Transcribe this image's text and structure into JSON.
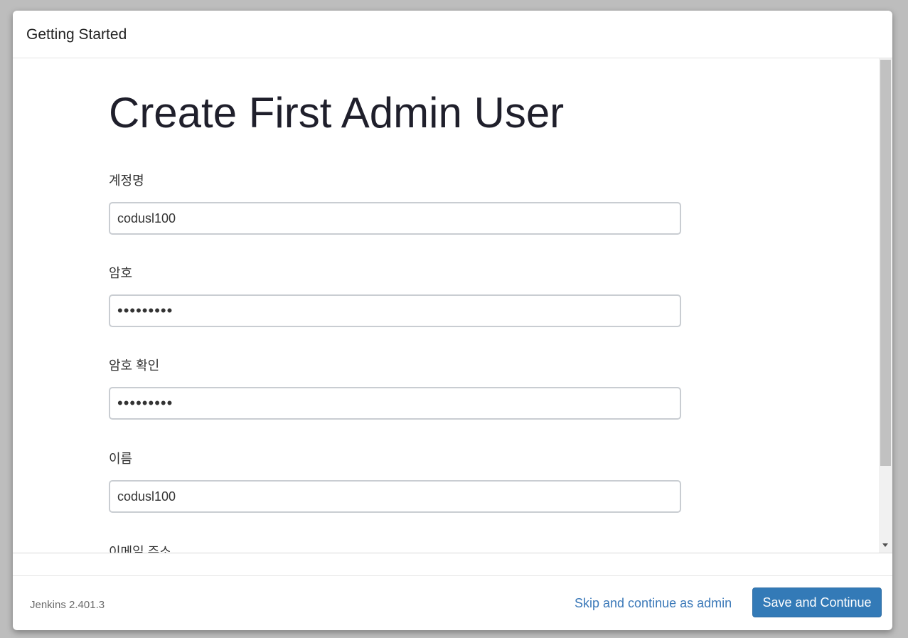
{
  "header": {
    "title": "Getting Started"
  },
  "form": {
    "title": "Create First Admin User",
    "fields": [
      {
        "label": "계정명",
        "value": "codusl100",
        "type": "text"
      },
      {
        "label": "암호",
        "value": "•••••••••",
        "type": "password"
      },
      {
        "label": "암호 확인",
        "value": "•••••••••",
        "type": "password"
      },
      {
        "label": "이름",
        "value": "codusl100",
        "type": "text"
      },
      {
        "label": "이메일 주소"
      }
    ]
  },
  "footer": {
    "version": "Jenkins 2.401.3",
    "skip_label": "Skip and continue as admin",
    "save_label": "Save and Continue"
  },
  "colors": {
    "primary_button": "#337ab7",
    "link": "#3a78b8"
  }
}
